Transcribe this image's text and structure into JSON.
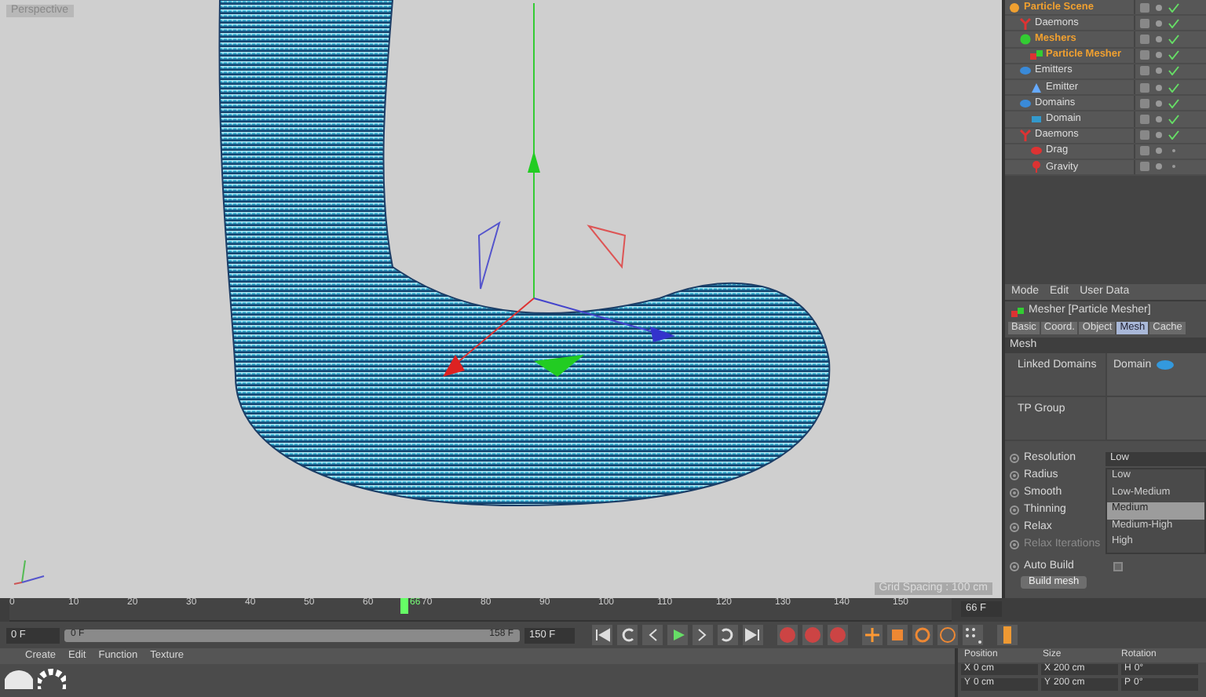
{
  "viewport": {
    "label": "Perspective",
    "grid_spacing": "Grid Spacing : 100 cm"
  },
  "object_manager": {
    "items": [
      {
        "name": "Particle Scene",
        "kind": "scene",
        "selected": true,
        "enabled": true,
        "children": [
          {
            "name": "Daemons",
            "kind": "daemon",
            "selected": false,
            "enabled": true
          },
          {
            "name": "Meshers",
            "kind": "mesher",
            "selected": true,
            "enabled": true,
            "children": [
              {
                "name": "Particle Mesher",
                "kind": "mesher-tag",
                "selected": true,
                "enabled": true
              }
            ]
          },
          {
            "name": "Emitters",
            "kind": "group",
            "selected": false,
            "enabled": true,
            "children": [
              {
                "name": "Emitter",
                "kind": "emitter",
                "selected": false,
                "enabled": true
              }
            ]
          },
          {
            "name": "Domains",
            "kind": "group",
            "selected": false,
            "enabled": true,
            "children": [
              {
                "name": "Domain",
                "kind": "domain",
                "selected": false,
                "enabled": true
              }
            ]
          },
          {
            "name": "Daemons",
            "kind": "daemon",
            "selected": false,
            "enabled": true,
            "children": [
              {
                "name": "Drag",
                "kind": "drag",
                "selected": false,
                "enabled": false
              },
              {
                "name": "Gravity",
                "kind": "gravity",
                "selected": false,
                "enabled": false
              }
            ]
          }
        ]
      }
    ]
  },
  "attributes": {
    "menu": [
      "Mode",
      "Edit",
      "User Data"
    ],
    "title": "Mesher [Particle Mesher]",
    "tabs": [
      {
        "label": "Basic",
        "selected": false
      },
      {
        "label": "Coord.",
        "selected": false
      },
      {
        "label": "Object",
        "selected": false
      },
      {
        "label": "Mesh",
        "selected": true
      },
      {
        "label": "Cache",
        "selected": false
      }
    ],
    "section": "Mesh",
    "links": [
      {
        "label": "Linked Domains",
        "value": "Domain"
      },
      {
        "label": "TP Group"
      }
    ],
    "resolution": {
      "label": "Resolution",
      "value": "Low",
      "options": [
        {
          "label": "Low",
          "highlighted": false
        },
        {
          "label": "Low-Medium",
          "highlighted": false
        },
        {
          "label": "Medium",
          "highlighted": true
        },
        {
          "label": "Medium-High",
          "highlighted": false
        },
        {
          "label": "High",
          "highlighted": false
        }
      ]
    },
    "params": [
      {
        "label": "Radius",
        "disabled": false
      },
      {
        "label": "Smooth",
        "disabled": false
      },
      {
        "label": "Thinning",
        "disabled": false
      },
      {
        "label": "Relax",
        "disabled": false
      },
      {
        "label": "Relax Iterations",
        "disabled": true
      }
    ],
    "auto_build": {
      "label": "Auto Build",
      "checked": false
    },
    "build_button": "Build mesh"
  },
  "timeline": {
    "ticks": [
      "0",
      "10",
      "20",
      "30",
      "40",
      "50",
      "60",
      "70",
      "80",
      "90",
      "100",
      "110",
      "120",
      "130",
      "140",
      "150"
    ],
    "current": "66",
    "playhead": {
      "level": 0.415
    },
    "frame_field": "66 F",
    "start_field": "0 F",
    "range_level": {
      "level": 1
    },
    "range_start": "0 F",
    "range_end": "158 F",
    "end_field": "150 F"
  },
  "materials": {
    "menu": [
      "Create",
      "Edit",
      "Function",
      "Texture"
    ],
    "items": [
      {
        "kind": "plain"
      },
      {
        "kind": "ring"
      }
    ]
  },
  "coordinates": {
    "headers": [
      "Position",
      "Size",
      "Rotation"
    ],
    "rows": [
      {
        "axis": "X",
        "position": "0 cm",
        "size_axis": "X",
        "size": "200 cm",
        "rot_axis": "H",
        "rotation": "0°"
      },
      {
        "axis": "Y",
        "position": "0 cm",
        "size_axis": "Y",
        "size": "200 cm",
        "rot_axis": "P",
        "rotation": "0°"
      }
    ]
  }
}
